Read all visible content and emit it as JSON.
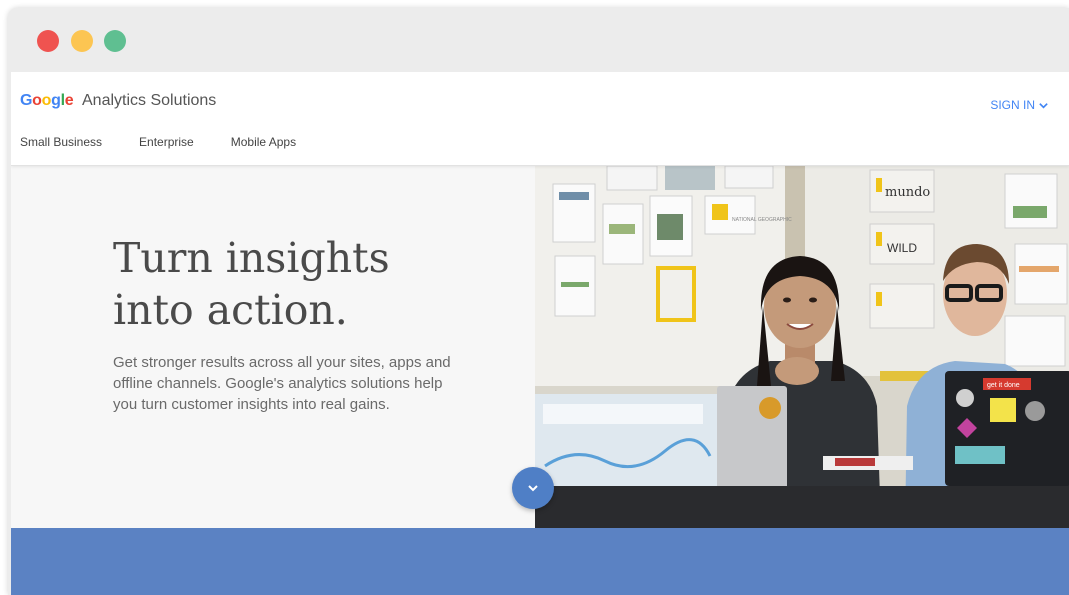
{
  "window": {
    "controls": [
      "close",
      "minimize",
      "maximize"
    ]
  },
  "header": {
    "logo_text": "Google",
    "product_name": "Analytics Solutions",
    "sign_in_label": "SIGN IN",
    "nav": [
      "Small Business",
      "Enterprise",
      "Mobile Apps"
    ]
  },
  "hero": {
    "headline_line1": "Turn insights",
    "headline_line2": "into action.",
    "subcopy": "Get stronger results across all your sites, apps and offline channels. Google's analytics solutions help you turn customer insights into real gains.",
    "photo_alt": "Two colleagues smiling at laptops in a meeting room",
    "wall_labels": [
      "mundo",
      "WILD",
      "NATIONAL GEOGRAPHIC",
      "get it done"
    ]
  },
  "colors": {
    "accent": "#4285f4",
    "band": "#5b82c3",
    "scroll_button": "#4f7fc6",
    "traffic_red": "#ef5350",
    "traffic_yellow": "#fcc552",
    "traffic_green": "#5fbf91"
  },
  "icons": {
    "sign_in": "chevron-down-icon",
    "scroll": "chevron-down-icon"
  }
}
